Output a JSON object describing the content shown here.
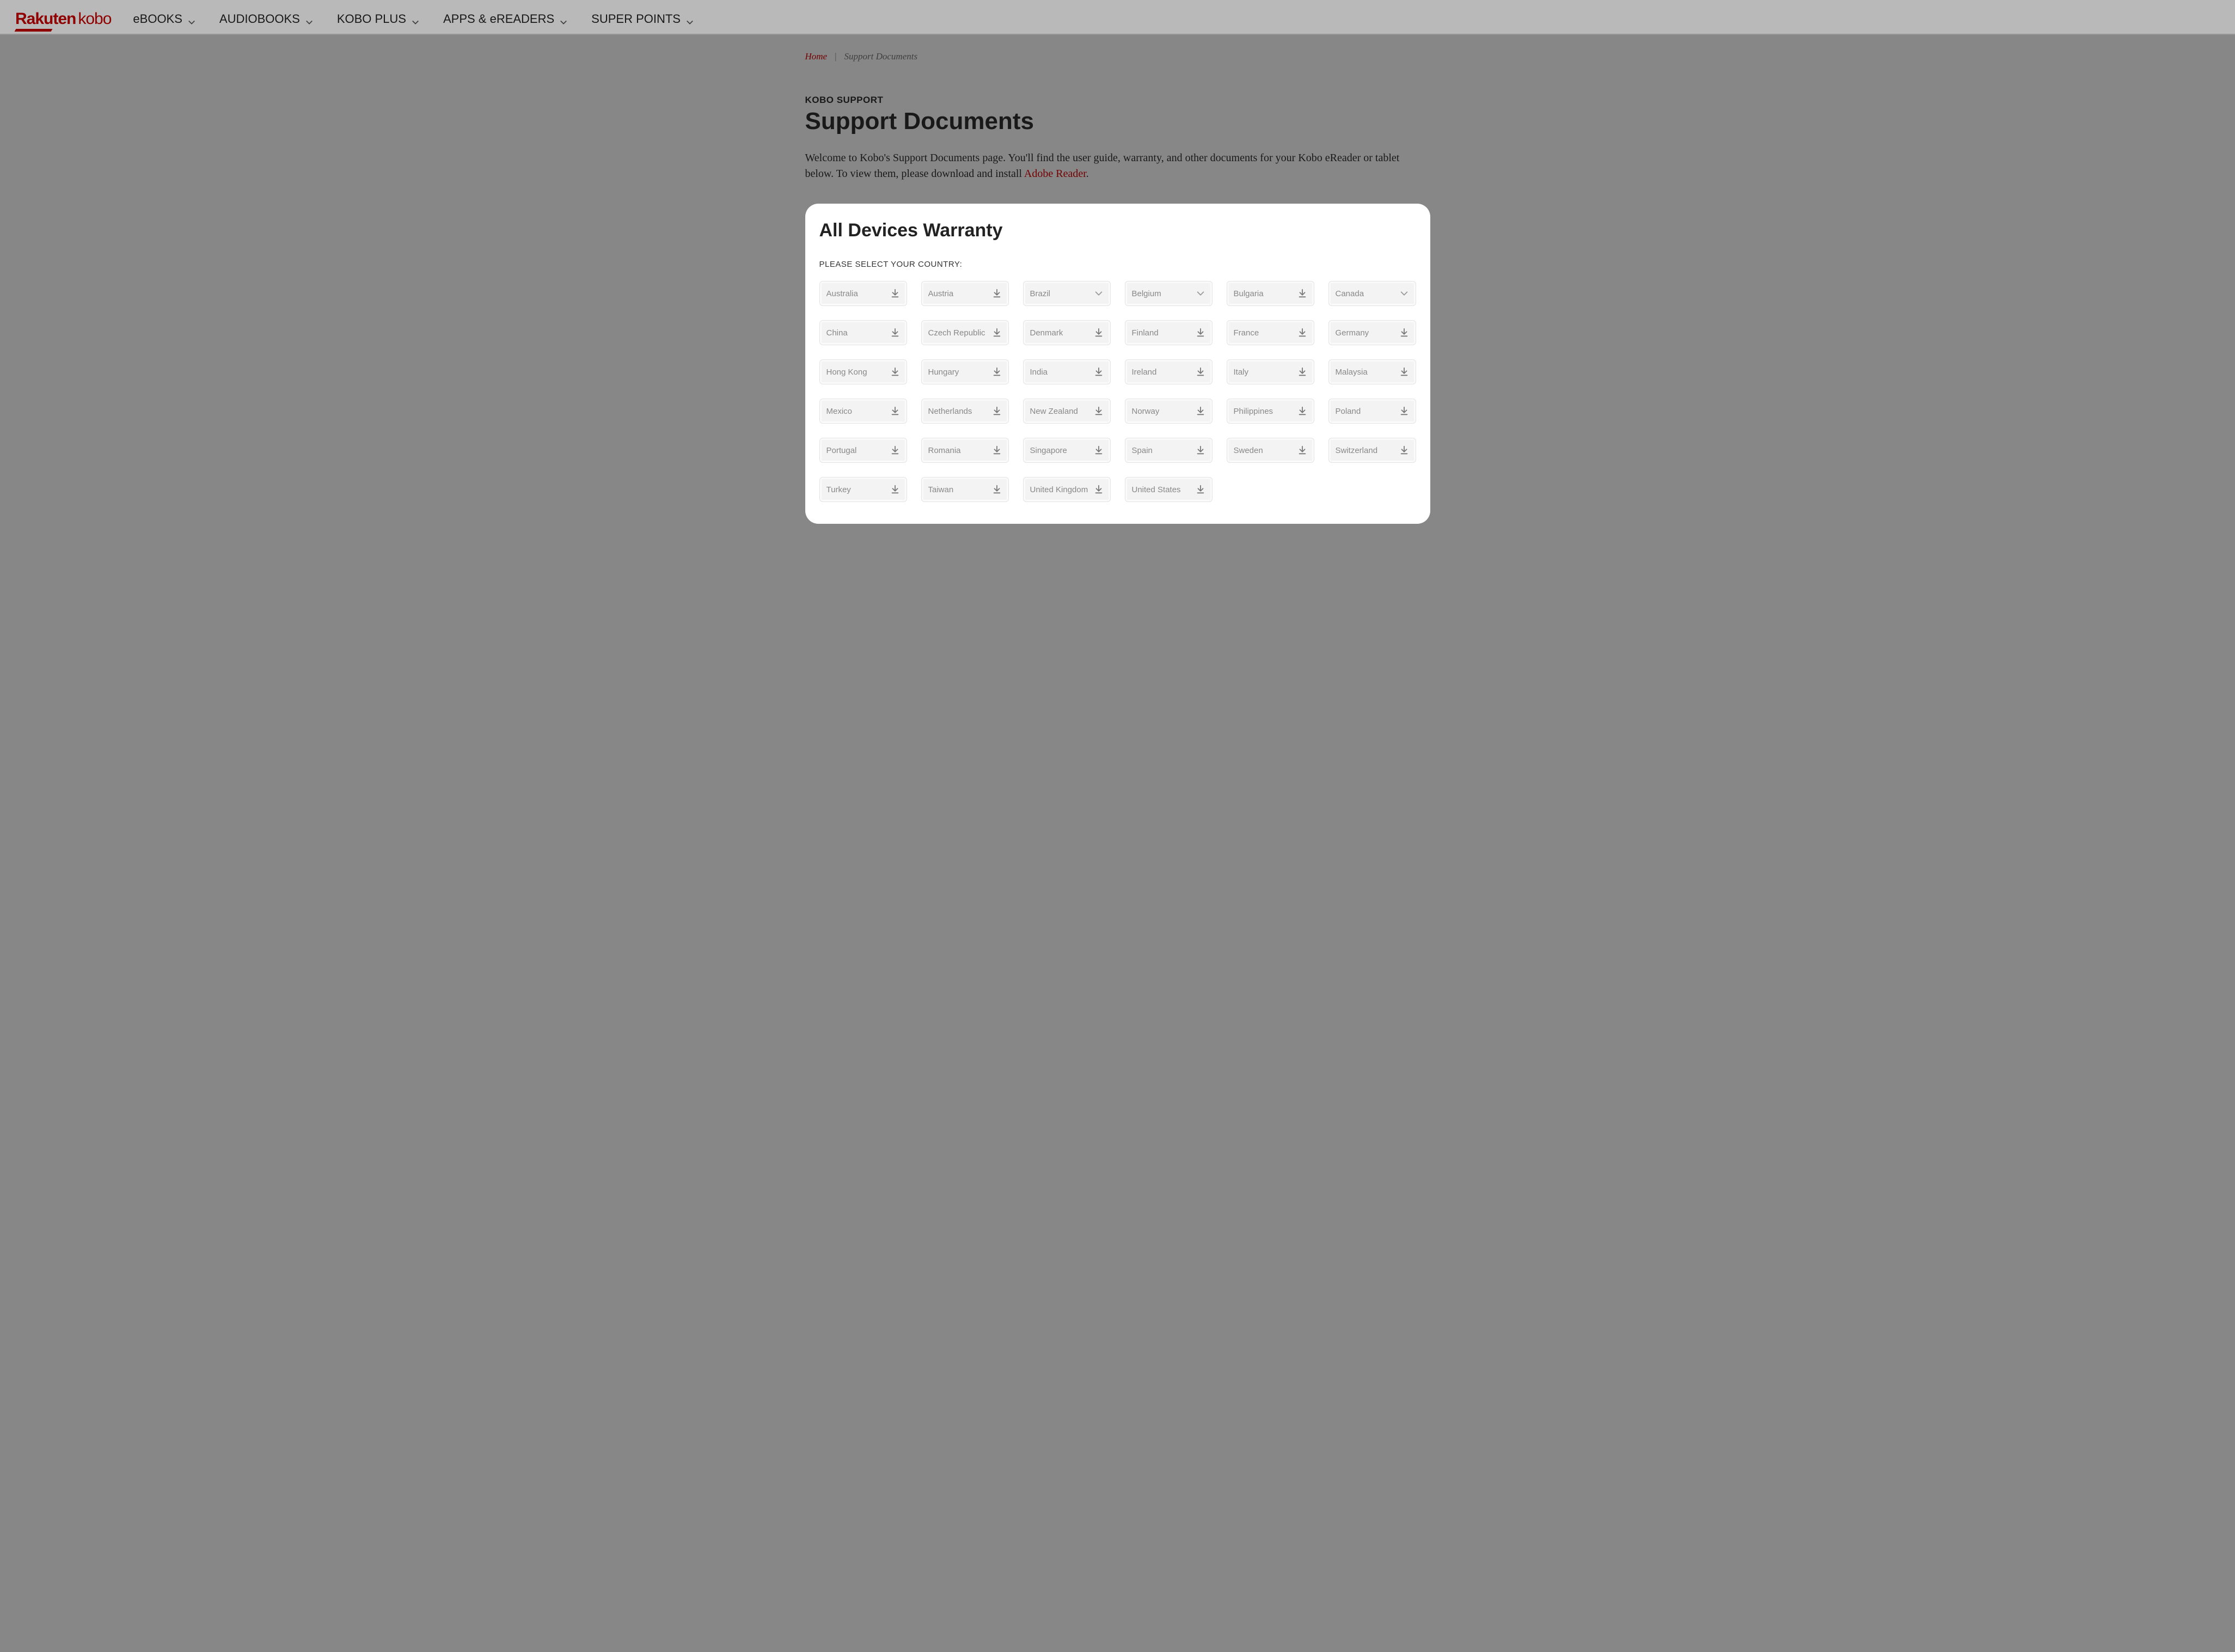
{
  "logo": {
    "rakuten": "Rakuten",
    "kobo": "kobo"
  },
  "nav": {
    "items": [
      {
        "label": "eBOOKS"
      },
      {
        "label": "AUDIOBOOKS"
      },
      {
        "label": "KOBO PLUS"
      },
      {
        "label": "APPS & eREADERS"
      },
      {
        "label": "SUPER POINTS"
      }
    ]
  },
  "breadcrumb": {
    "home": "Home",
    "current": "Support Documents"
  },
  "support_kicker": "KOBO SUPPORT",
  "page_title": "Support Documents",
  "intro_prefix": "Welcome to Kobo's Support Documents page. You'll find the user guide, warranty, and other documents for your Kobo eReader or tablet below. To view them, please download and install ",
  "intro_link": "Adobe Reader",
  "intro_suffix": ".",
  "card": {
    "title": "All Devices Warranty",
    "select_label": "PLEASE SELECT YOUR COUNTRY:",
    "countries": [
      {
        "name": "Australia",
        "icon": "download"
      },
      {
        "name": "Austria",
        "icon": "download"
      },
      {
        "name": "Brazil",
        "icon": "select"
      },
      {
        "name": "Belgium",
        "icon": "select"
      },
      {
        "name": "Bulgaria",
        "icon": "download"
      },
      {
        "name": "Canada",
        "icon": "select"
      },
      {
        "name": "China",
        "icon": "download"
      },
      {
        "name": "Czech Republic",
        "icon": "download"
      },
      {
        "name": "Denmark",
        "icon": "download"
      },
      {
        "name": "Finland",
        "icon": "download"
      },
      {
        "name": "France",
        "icon": "download"
      },
      {
        "name": "Germany",
        "icon": "download"
      },
      {
        "name": "Hong Kong",
        "icon": "download"
      },
      {
        "name": "Hungary",
        "icon": "download"
      },
      {
        "name": "India",
        "icon": "download"
      },
      {
        "name": "Ireland",
        "icon": "download"
      },
      {
        "name": "Italy",
        "icon": "download"
      },
      {
        "name": "Malaysia",
        "icon": "download"
      },
      {
        "name": "Mexico",
        "icon": "download"
      },
      {
        "name": "Netherlands",
        "icon": "download"
      },
      {
        "name": "New Zealand",
        "icon": "download"
      },
      {
        "name": "Norway",
        "icon": "download"
      },
      {
        "name": "Philippines",
        "icon": "download"
      },
      {
        "name": "Poland",
        "icon": "download"
      },
      {
        "name": "Portugal",
        "icon": "download"
      },
      {
        "name": "Romania",
        "icon": "download"
      },
      {
        "name": "Singapore",
        "icon": "download"
      },
      {
        "name": "Spain",
        "icon": "download"
      },
      {
        "name": "Sweden",
        "icon": "download"
      },
      {
        "name": "Switzerland",
        "icon": "download"
      },
      {
        "name": "Turkey",
        "icon": "download"
      },
      {
        "name": "Taiwan",
        "icon": "download"
      },
      {
        "name": "United Kingdom",
        "icon": "download"
      },
      {
        "name": "United States",
        "icon": "download"
      }
    ]
  }
}
